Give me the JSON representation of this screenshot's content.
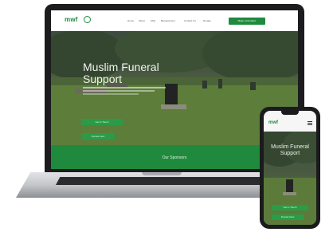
{
  "site": {
    "logo_text": "mwf",
    "nav_links": [
      "Home",
      "About",
      "FAQ",
      "Bereavement",
      "Contact Us",
      "Donate"
    ],
    "nav_cta": "Make a Donation",
    "hero_title": "Muslim Funeral Support",
    "hero_button_primary": "Get in Touch",
    "hero_button_secondary": "Donate Now",
    "sponsors_heading": "Our Sponsors"
  },
  "phone": {
    "logo_text": "mwf",
    "hero_title": "Muslim Funeral Support",
    "button_primary": "Get in Touch",
    "button_secondary": "Donate Now"
  },
  "colors": {
    "brand_green": "#1f8a3e",
    "button_green": "#2a9c47"
  }
}
